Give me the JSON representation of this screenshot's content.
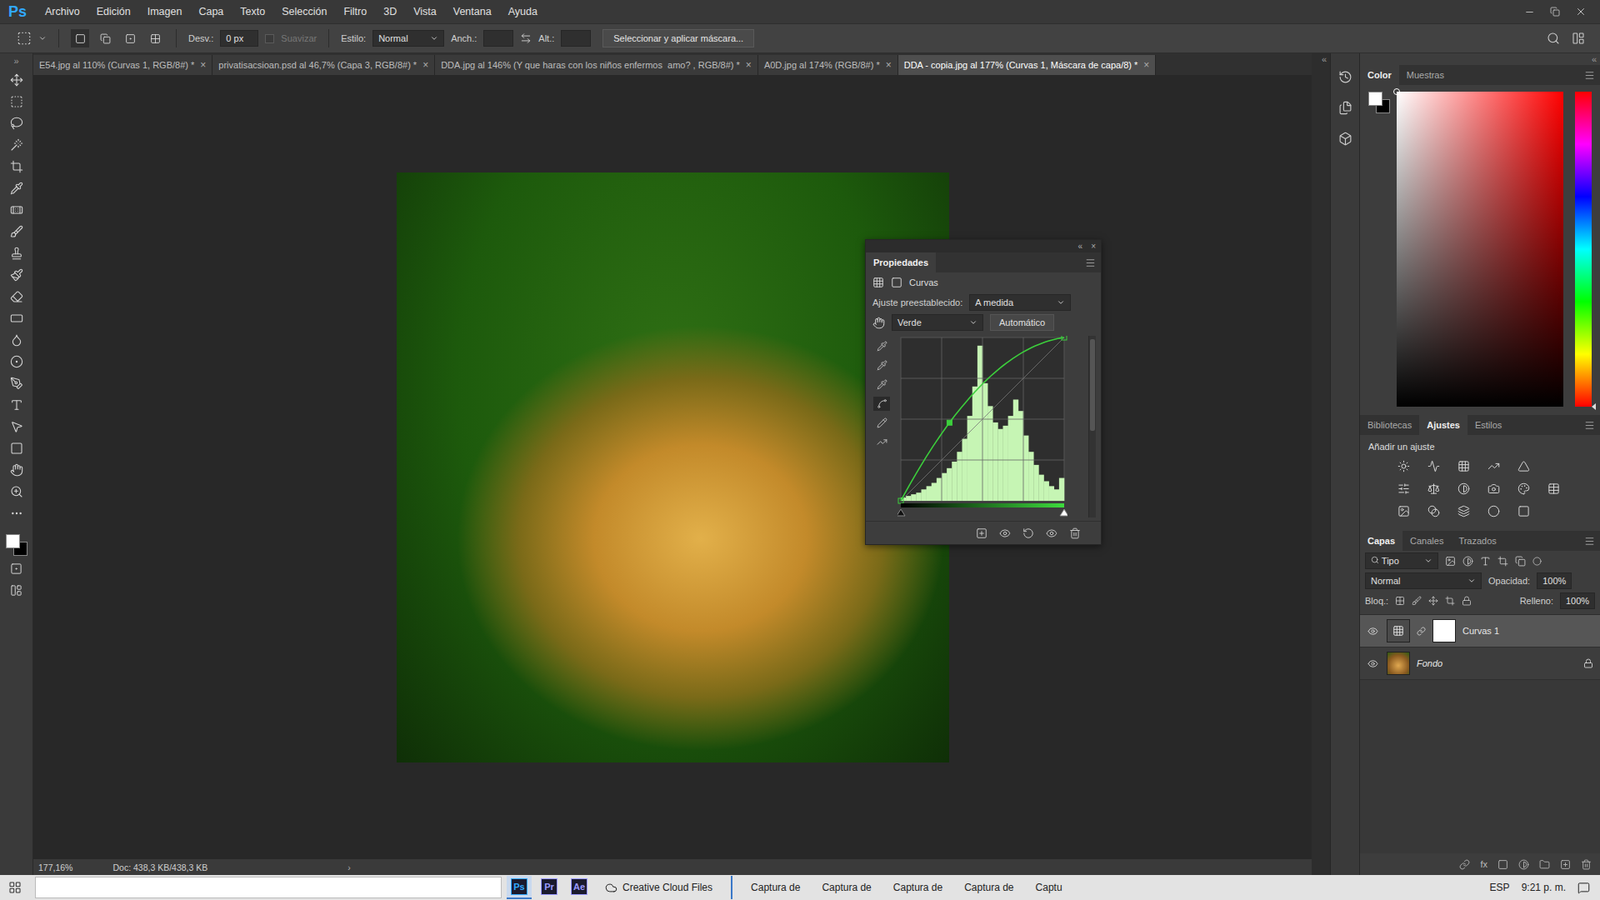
{
  "app": {
    "logo": "Ps",
    "toolbar_collapse": "»",
    "dock_collapse": "«"
  },
  "menu": [
    "Archivo",
    "Edición",
    "Imagen",
    "Capa",
    "Texto",
    "Selección",
    "Filtro",
    "3D",
    "Vista",
    "Ventana",
    "Ayuda"
  ],
  "options_bar": {
    "feather_label": "Desv.:",
    "feather_value": "0 px",
    "antialias_label": "Suavizar",
    "antialias_disabled": true,
    "style_label": "Estilo:",
    "style_value": "Normal",
    "width_label": "Anch.:",
    "height_label": "Alt.:",
    "mask_button": "Seleccionar y aplicar máscara..."
  },
  "tabs": [
    {
      "label": "E54.jpg al 110% (Curvas 1, RGB/8#) *",
      "close": "×",
      "selected": false
    },
    {
      "label": "privatisacsioan.psd al 46,7% (Capa 3, RGB/8#) *",
      "close": "×",
      "selected": false
    },
    {
      "label": "DDA.jpg al 146% (Y que haras con los niños enfermos  amo? , RGB/8#) *",
      "close": "×",
      "selected": false
    },
    {
      "label": "A0D.jpg al 174% (RGB/8#) *",
      "close": "×",
      "selected": false
    },
    {
      "label": "DDA - copia.jpg al 177% (Curvas 1, Máscara de capa/8) *",
      "close": "×",
      "selected": true
    }
  ],
  "properties": {
    "collapse": "«",
    "close": "×",
    "title": "Propiedades",
    "adjustment": "Curvas",
    "preset_label": "Ajuste preestablecido:",
    "preset": "A medida",
    "channel": "Verde",
    "auto_button": "Automático",
    "histogram": [
      2,
      3,
      4,
      5,
      7,
      9,
      11,
      14,
      17,
      20,
      24,
      30,
      38,
      52,
      70,
      95,
      72,
      58,
      48,
      44,
      46,
      52,
      62,
      55,
      40,
      30,
      22,
      16,
      12,
      9,
      7,
      14
    ],
    "curve_points": [
      [
        0,
        0
      ],
      [
        76,
        122
      ],
      [
        255,
        255
      ]
    ]
  },
  "color_panel": {
    "tabs": [
      {
        "label": "Color",
        "selected": true
      },
      {
        "label": "Muestras",
        "selected": false
      }
    ],
    "foreground": "#ffffff",
    "background": "#000000"
  },
  "adjustments_panel": {
    "tabs": [
      {
        "label": "Bibliotecas",
        "selected": false
      },
      {
        "label": "Ajustes",
        "selected": true
      },
      {
        "label": "Estilos",
        "selected": false
      }
    ],
    "heading": "Añadir un ajuste"
  },
  "layers_panel": {
    "tabs": [
      {
        "label": "Capas",
        "selected": true
      },
      {
        "label": "Canales",
        "selected": false
      },
      {
        "label": "Trazados",
        "selected": false
      }
    ],
    "filter": "Tipo",
    "blend_mode": "Normal",
    "opacity_label": "Opacidad:",
    "opacity": "100%",
    "lock_label": "Bloq.:",
    "fill_label": "Relleno:",
    "fill": "100%",
    "fx_label": "fx",
    "layers": [
      {
        "name": "Curvas 1",
        "kind": "adjustment",
        "visible": true,
        "selected": true,
        "locked": false
      },
      {
        "name": "Fondo",
        "kind": "image",
        "visible": true,
        "selected": false,
        "locked": true
      }
    ]
  },
  "status_bar": {
    "zoom": "177,16%",
    "doc": "Doc: 438,3 KB/438,3 KB",
    "arrow": "›"
  },
  "taskbar": {
    "apps": [
      {
        "label": "Ps",
        "color": "#31a8ff",
        "selected": true
      },
      {
        "label": "Pr",
        "color": "#9999ff",
        "selected": false
      },
      {
        "label": "Ae",
        "color": "#9999ff",
        "selected": false
      }
    ],
    "cloud_item": "Creative Cloud Files",
    "windows": [
      "Captura de",
      "Captura de",
      "Captura de",
      "Captura de",
      "Captu"
    ],
    "language": "ESP",
    "time": "9:21 p. m."
  }
}
